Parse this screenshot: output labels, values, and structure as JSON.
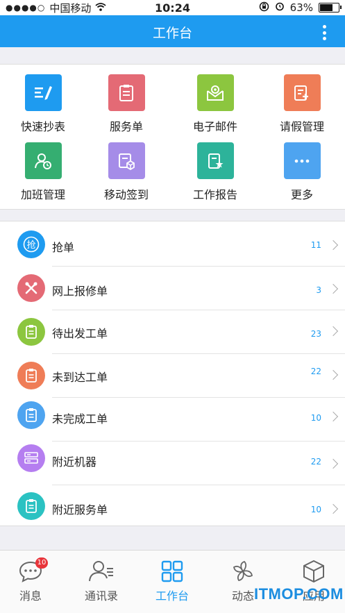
{
  "status_bar": {
    "signal": "●●●●○",
    "carrier": "中国移动",
    "time": "10:24",
    "battery": "63%"
  },
  "header": {
    "title": "工作台"
  },
  "grid": [
    {
      "label": "快速抄表",
      "color": "#1e9bf0",
      "icon": "edit-list-icon"
    },
    {
      "label": "服务单",
      "color": "#e46a75",
      "icon": "clipboard-icon"
    },
    {
      "label": "电子邮件",
      "color": "#8cc63f",
      "icon": "mail-icon"
    },
    {
      "label": "请假管理",
      "color": "#ef7d57",
      "icon": "leave-form-icon"
    },
    {
      "label": "加班管理",
      "color": "#35ae71",
      "icon": "user-clock-icon"
    },
    {
      "label": "移动签到",
      "color": "#a58ce8",
      "icon": "checkin-box-icon"
    },
    {
      "label": "工作报告",
      "color": "#2db39a",
      "icon": "report-star-icon"
    },
    {
      "label": "更多",
      "color": "#4ea4f0",
      "icon": "more-dots-icon"
    }
  ],
  "list": [
    {
      "label": "抢单",
      "count": "11",
      "color": "#1e9bf0",
      "icon": "grab-icon"
    },
    {
      "label": "网上报修单",
      "count": "3",
      "color": "#e46a75",
      "icon": "tools-icon"
    },
    {
      "label": "待出发工单",
      "count": "23",
      "color": "#8cc63f",
      "icon": "clipboard-icon"
    },
    {
      "label": "未到达工单",
      "count": "22",
      "color": "#ef7d57",
      "icon": "clipboard-icon"
    },
    {
      "label": "未完成工单",
      "count": "10",
      "color": "#4ea4f0",
      "icon": "clipboard-icon"
    },
    {
      "label": "附近机器",
      "count": "22",
      "color": "#b57ef0",
      "icon": "server-icon"
    },
    {
      "label": "附近服务单",
      "count": "10",
      "color": "#2bc2c2",
      "icon": "clipboard-icon"
    }
  ],
  "list_icon_text": "抢",
  "tabs": [
    {
      "label": "消息",
      "badge": "10",
      "icon": "chat-icon"
    },
    {
      "label": "通讯录",
      "icon": "contacts-icon"
    },
    {
      "label": "工作台",
      "icon": "grid-icon",
      "active": true
    },
    {
      "label": "动态",
      "icon": "pinwheel-icon"
    },
    {
      "label": "应用",
      "icon": "cube-icon"
    }
  ],
  "watermark": "ITMOP.COM",
  "accent_color": "#1e9bf0"
}
